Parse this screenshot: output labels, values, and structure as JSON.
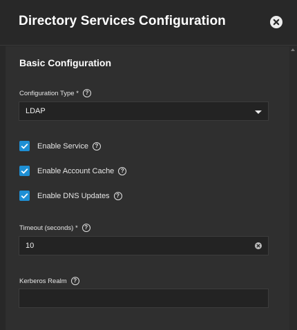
{
  "dialog": {
    "title": "Directory Services Configuration",
    "close_icon": "close-circle-icon"
  },
  "section": {
    "title": "Basic Configuration"
  },
  "configuration_type": {
    "label": "Configuration Type *",
    "value": "LDAP",
    "help_icon": "help-circle-icon",
    "dropdown_icon": "chevron-down-icon"
  },
  "checkboxes": {
    "enable_service": {
      "label": "Enable Service",
      "checked": true
    },
    "enable_account_cache": {
      "label": "Enable Account Cache",
      "checked": true
    },
    "enable_dns_updates": {
      "label": "Enable DNS Updates",
      "checked": true
    }
  },
  "timeout": {
    "label": "Timeout (seconds) *",
    "value": "10",
    "clear_icon": "clear-circle-icon"
  },
  "kerberos_realm": {
    "label": "Kerberos Realm",
    "value": ""
  },
  "help_glyph": "?",
  "colors": {
    "accent": "#1e8fd4",
    "background": "#282828",
    "panel": "#2f2f2f",
    "input_background": "#232323"
  }
}
